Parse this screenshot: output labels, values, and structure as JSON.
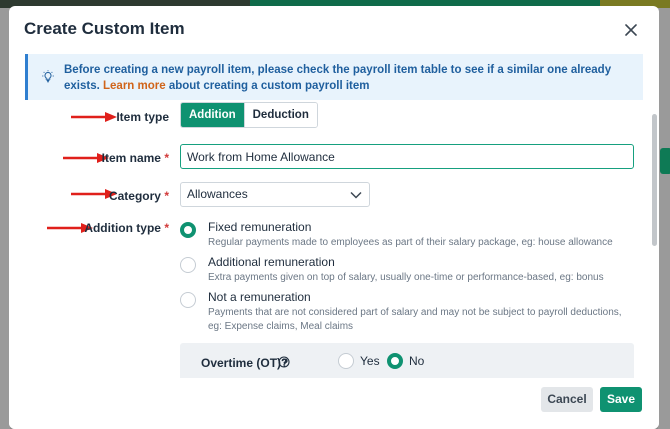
{
  "modal": {
    "title": "Create Custom Item",
    "close_icon": "close-icon"
  },
  "info_banner": {
    "icon": "lightbulb-icon",
    "text_before": "Before creating a new payroll item, please check the payroll item table to see if a similar one already exists. ",
    "learn_more": "Learn more",
    "text_after": " about creating a custom payroll item"
  },
  "form": {
    "item_type": {
      "label": "Item type",
      "options": [
        "Addition",
        "Deduction"
      ],
      "selected": "Addition"
    },
    "item_name": {
      "label": "Item name",
      "required_mark": "*",
      "value": "Work from Home Allowance"
    },
    "category": {
      "label": "Category",
      "required_mark": "*",
      "value": "Allowances"
    },
    "addition_type": {
      "label": "Addition type",
      "required_mark": "*",
      "options": [
        {
          "title": "Fixed remuneration",
          "description": "Regular payments made to employees as part of their salary package, eg: house allowance",
          "checked": true
        },
        {
          "title": "Additional remuneration",
          "description": "Extra payments given on top of salary, usually one-time or performance-based, eg: bonus",
          "checked": false
        },
        {
          "title": "Not a remuneration",
          "description": "Payments that are not considered part of salary and may not be subject to payroll deductions, eg: Expense claims, Meal claims",
          "checked": false
        }
      ]
    },
    "overtime": {
      "label": "Overtime (OT)?",
      "help_icon": "help-circle-icon",
      "yes_label": "Yes",
      "no_label": "No",
      "selected": "No"
    }
  },
  "footer": {
    "cancel_label": "Cancel",
    "save_label": "Save"
  },
  "colors": {
    "primary": "#0f9271",
    "info_text": "#1f5f9e",
    "link": "#d0641a",
    "required": "#d23a3a",
    "arrow": "#e0201b"
  }
}
